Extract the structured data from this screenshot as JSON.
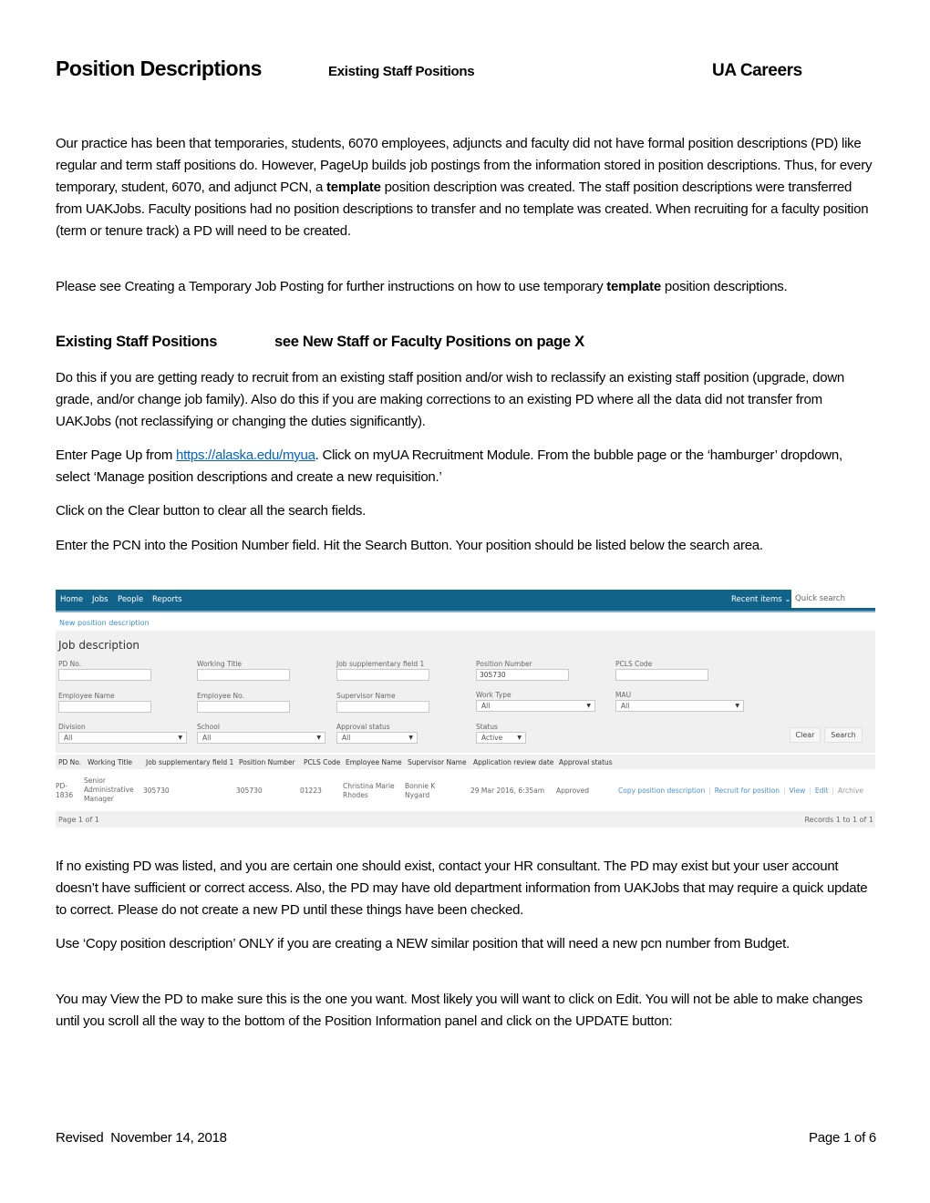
{
  "header": {
    "title": "Position Descriptions",
    "subtitle": "Existing Staff Positions",
    "right": "UA Careers"
  },
  "paragraphs": {
    "p1_a": "Our practice has been that temporaries, students, 6070 employees, adjuncts and faculty did not have formal position descriptions (PD) like regular and term staff positions do.  However, PageUp builds job postings from the information stored in position descriptions.  Thus, for every temporary, student, 6070, and adjunct PCN, a ",
    "p1_bold": "template",
    "p1_b": " position description was created.  The staff position descriptions were transferred from UAKJobs.  Faculty positions had no position descriptions to transfer and no template was created.  When recruiting for a faculty position (term or tenure track) a PD will need to be created.",
    "p2_a": "Please see Creating a Temporary Job Posting for further instructions on how to use temporary ",
    "p2_bold": "template",
    "p2_b": " position descriptions.",
    "section_heading": "Existing Staff Positions",
    "section_heading_right": "see New Staff or Faculty Positions on page X",
    "p3": "Do this if you are getting ready to recruit from an existing staff position and/or wish to reclassify an existing staff position (upgrade, down grade, and/or change job family).  Also do this if you are making corrections to an existing PD where all the data did not transfer from UAKJobs (not reclassifying or changing the duties significantly).",
    "p4_a": "Enter Page Up from ",
    "p4_link": "https://alaska.edu/myua",
    "p4_b": ". Click on myUA Recruitment Module.  From the bubble page or the ‘hamburger’ dropdown, select ‘Manage position descriptions and create a new requisition.’",
    "p5": "Click on the Clear button to clear all the search fields.",
    "p6": "Enter the PCN into the Position Number field.  Hit the Search Button.  Your position should be listed below the search area.",
    "p7": "If no existing PD was listed, and you are certain one should exist, contact your HR consultant.  The PD may exist but your user account doesn’t have sufficient or correct access.  Also, the PD may have old department information from UAKJobs that may require a quick update to correct.  Please do not create a new PD until these things have been checked.",
    "p8": "Use ‘Copy position description’ ONLY if you are creating a NEW similar position that will need a new pcn number from Budget.",
    "p9": "You may View the PD to make sure this is the one you want.  Most likely you will want to click on Edit.  You will not be able to make changes until you scroll all the way to the bottom of the Position Information panel and click on the UPDATE button:"
  },
  "app": {
    "nav": [
      "Home",
      "Jobs",
      "People",
      "Reports"
    ],
    "recent_items": "Recent items ⌄",
    "quick_search_placeholder": "Quick search",
    "new_pd_link": "New position description",
    "panel_title": "Job description",
    "fields": {
      "pd_no": {
        "label": "PD No.",
        "value": ""
      },
      "working_title": {
        "label": "Working Title",
        "value": ""
      },
      "job_supp": {
        "label": "Job supplementary field 1",
        "value": ""
      },
      "position_number": {
        "label": "Position Number",
        "value": "305730"
      },
      "pcls_code": {
        "label": "PCLS Code",
        "value": ""
      },
      "employee_name": {
        "label": "Employee Name",
        "value": ""
      },
      "employee_no": {
        "label": "Employee No.",
        "value": ""
      },
      "supervisor_name": {
        "label": "Supervisor Name",
        "value": ""
      },
      "work_type": {
        "label": "Work Type",
        "value": "All"
      },
      "mau": {
        "label": "MAU",
        "value": "All"
      },
      "division": {
        "label": "Division",
        "value": "All"
      },
      "school": {
        "label": "School",
        "value": "All"
      },
      "approval_status": {
        "label": "Approval status",
        "value": "All"
      },
      "status": {
        "label": "Status",
        "value": "Active"
      }
    },
    "buttons": {
      "clear": "Clear",
      "search": "Search"
    },
    "table": {
      "columns": [
        "PD No.",
        "Working Title",
        "Job supplementary field 1",
        "Position Number",
        "PCLS Code",
        "Employee Name",
        "Supervisor Name",
        "Application review date",
        "Approval status"
      ],
      "rows": [
        {
          "pd_no": "PD-1836",
          "working_title": "Senior Administrative Manager",
          "job_supp": "305730",
          "position_number": "305730",
          "pcls_code": "01223",
          "employee_name": "Christina Marie Rhodes",
          "supervisor_name": "Bonnie K Nygard",
          "review_date": "29 Mar 2016, 6:35am",
          "approval_status": "Approved",
          "actions": [
            "Copy position description",
            "Recruit for position",
            "View",
            "Edit",
            "Archive"
          ]
        }
      ],
      "pager": "Page 1 of 1",
      "records": "Records 1 to 1 of 1"
    }
  },
  "footer": {
    "revised": "Revised  November 14, 2018",
    "page": "Page 1 of 6"
  }
}
